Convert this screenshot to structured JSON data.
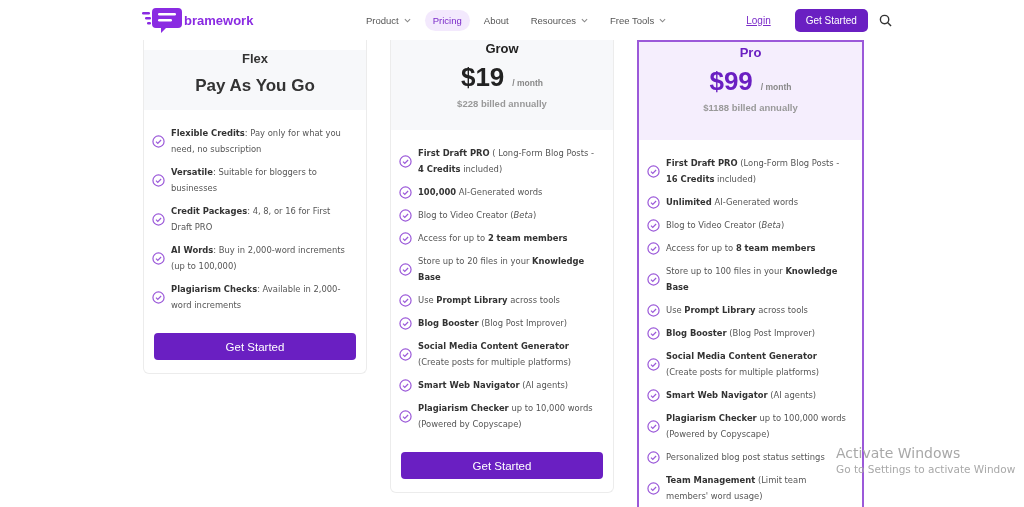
{
  "nav": {
    "brand": "bramework",
    "links": [
      {
        "label": "Product",
        "selected": false,
        "dropdown": true
      },
      {
        "label": "Pricing",
        "selected": true,
        "dropdown": false
      },
      {
        "label": "About",
        "selected": false,
        "dropdown": false
      },
      {
        "label": "Resources",
        "selected": false,
        "dropdown": true
      },
      {
        "label": "Free Tools",
        "selected": false,
        "dropdown": true
      }
    ],
    "login": "Login",
    "cta": "Get Started"
  },
  "plans": [
    {
      "name": "Flex",
      "kind": "tagline",
      "tagline": "Pay As You Go",
      "highlighted": false,
      "button": "Get Started",
      "features": [
        "**Flexible Credits**: Pay only for what you need, no subscription",
        "**Versatile**: Suitable for bloggers to businesses",
        "**Credit Packages**: 4, 8, or 16 for First Draft PRO",
        "**AI Words**: Buy in 2,000-word increments (up to 100,000)",
        "**Plagiarism Checks**: Available in 2,000-word increments"
      ]
    },
    {
      "name": "Grow",
      "kind": "price",
      "price": "$19",
      "period": "/ month",
      "billed": "$228 billed annually",
      "highlighted": false,
      "button": "Get Started",
      "features": [
        "**First Draft PRO** ( Long-Form Blog Posts - **4 Credits** included)",
        "**100,000** AI-Generated words",
        "Blog to Video Creator (*Beta*)",
        "Access for up to **2 team members**",
        "Store up to 20 files in your **Knowledge Base**",
        "Use **Prompt Library** across tools",
        "**Blog Booster** (Blog Post Improver)",
        "**Social Media Content Generator** (Create posts for multiple platforms)",
        "**Smart Web Navigator** (AI agents)",
        "**Plagiarism Checker** up to 10,000 words (Powered by Copyscape)"
      ]
    },
    {
      "name": "Pro",
      "kind": "price",
      "price": "$99",
      "period": "/ month",
      "billed": "$1188 billed annually",
      "highlighted": true,
      "features": [
        "**First Draft PRO** (Long-Form Blog Posts - **16 Credits** included)",
        "**Unlimited** AI-Generated words",
        "Blog to Video Creator (*Beta*)",
        "Access for up to **8 team members**",
        "Store up to 100 files in your **Knowledge Base**",
        "Use **Prompt Library** across tools",
        "**Blog Booster** (Blog Post Improver)",
        "**Social Media Content Generator** (Create posts for multiple platforms)",
        "**Smart Web Navigator** (AI agents)",
        "**Plagiarism Checker** up to 100,000 words (Powered by Copyscape)",
        "Personalized blog post status settings",
        "**Team Management** (Limit team members' word usage)"
      ]
    }
  ],
  "os_notice": {
    "title": "Activate Windows",
    "subtitle": "Go to Settings to activate Window"
  }
}
